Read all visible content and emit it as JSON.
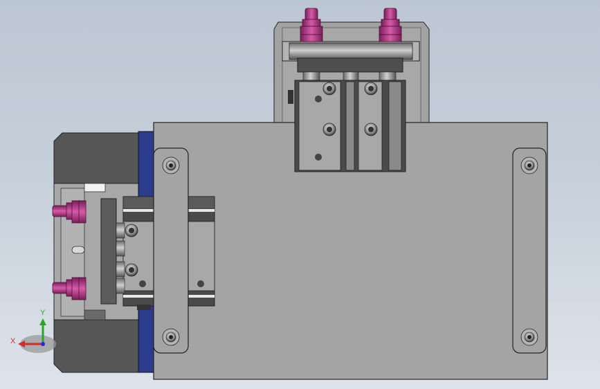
{
  "viewport": {
    "background_top": "#bcc7d3",
    "background_bottom": "#dde3ea"
  },
  "colors": {
    "plate": "#a4a4a4",
    "dark_block": "#5a5a5a",
    "blue_strip": "#2b3c8c",
    "fitting": "#b8408c",
    "steel": "#8c8c8c",
    "edge": "#2a2a2a"
  },
  "triad": {
    "x_label": "X",
    "y_label": "Y",
    "x_color": "#d42a2a",
    "y_color": "#2aa52a",
    "z_color": "#2a2ad4"
  }
}
